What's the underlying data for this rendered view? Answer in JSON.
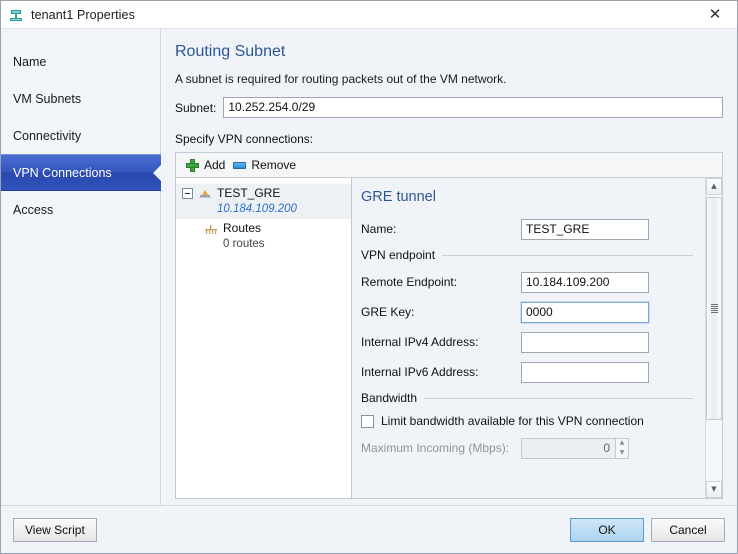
{
  "window": {
    "title": "tenant1 Properties",
    "icon": "network-subnet-icon",
    "close_label": "✕"
  },
  "sidebar": {
    "items": [
      {
        "label": "Name",
        "selected": false
      },
      {
        "label": "VM Subnets",
        "selected": false
      },
      {
        "label": "Connectivity",
        "selected": false
      },
      {
        "label": "VPN Connections",
        "selected": true
      },
      {
        "label": "Access",
        "selected": false
      }
    ]
  },
  "main": {
    "section_title": "Routing Subnet",
    "section_desc": "A subnet is required for routing packets out of the VM network.",
    "subnet_label": "Subnet:",
    "subnet_value": "10.252.254.0/29",
    "specify_label": "Specify VPN connections:"
  },
  "toolbar": {
    "add_label": "Add",
    "remove_label": "Remove",
    "add_icon": "plus-icon",
    "remove_icon": "minus-icon"
  },
  "tree": {
    "root": {
      "name": "TEST_GRE",
      "sub": "10.184.109.200",
      "icon": "vpn-tunnel-icon",
      "expander": "collapse-toggle"
    },
    "child": {
      "name": "Routes",
      "sub": "0 routes",
      "icon": "routes-icon"
    }
  },
  "detail": {
    "title": "GRE tunnel",
    "name_label": "Name:",
    "name_value": "TEST_GRE",
    "endpoint_group": "VPN endpoint",
    "remote_label": "Remote Endpoint:",
    "remote_value": "10.184.109.200",
    "gre_key_label": "GRE Key:",
    "gre_key_value": "0000",
    "ipv4_label": "Internal IPv4 Address:",
    "ipv4_value": "",
    "ipv6_label": "Internal IPv6 Address:",
    "ipv6_value": "",
    "bandwidth_group": "Bandwidth",
    "limit_checkbox_label": "Limit bandwidth available for this VPN connection",
    "limit_checked": false,
    "max_incoming_label": "Maximum Incoming (Mbps):",
    "max_incoming_value": "0",
    "spin_up": "▲",
    "spin_down": "▼"
  },
  "scrollbar": {
    "up_arrow": "▲",
    "down_arrow": "▼"
  },
  "footer": {
    "view_script": "View Script",
    "ok": "OK",
    "cancel": "Cancel"
  },
  "colors": {
    "accent_blue": "#2b5797",
    "selected_nav": "#3355bd",
    "link_blue": "#2a6fd0",
    "add_green": "#3fa63f",
    "remove_blue": "#2b8fd4",
    "primary_btn": "#aed4f0"
  }
}
